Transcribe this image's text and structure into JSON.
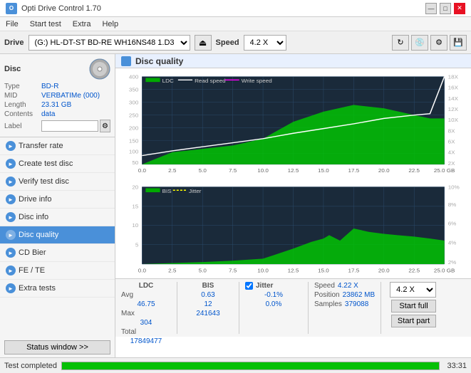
{
  "titlebar": {
    "title": "Opti Drive Control 1.70",
    "icon_label": "O",
    "controls": [
      "—",
      "□",
      "✕"
    ]
  },
  "menubar": {
    "items": [
      "File",
      "Start test",
      "Extra",
      "Help"
    ]
  },
  "drivebar": {
    "label": "Drive",
    "drive_value": "(G:)  HL-DT-ST BD-RE  WH16NS48 1.D3",
    "speed_label": "Speed",
    "speed_value": "4.2 X"
  },
  "disc": {
    "title": "Disc",
    "type_label": "Type",
    "type_value": "BD-R",
    "mid_label": "MID",
    "mid_value": "VERBATIMe (000)",
    "length_label": "Length",
    "length_value": "23.31 GB",
    "contents_label": "Contents",
    "contents_value": "data",
    "label_label": "Label"
  },
  "nav": {
    "items": [
      {
        "id": "transfer-rate",
        "label": "Transfer rate",
        "active": false
      },
      {
        "id": "create-test-disc",
        "label": "Create test disc",
        "active": false
      },
      {
        "id": "verify-test-disc",
        "label": "Verify test disc",
        "active": false
      },
      {
        "id": "drive-info",
        "label": "Drive info",
        "active": false
      },
      {
        "id": "disc-info",
        "label": "Disc info",
        "active": false
      },
      {
        "id": "disc-quality",
        "label": "Disc quality",
        "active": true
      },
      {
        "id": "cd-bier",
        "label": "CD Bier",
        "active": false
      },
      {
        "id": "fe-te",
        "label": "FE / TE",
        "active": false
      },
      {
        "id": "extra-tests",
        "label": "Extra tests",
        "active": false
      }
    ],
    "status_window": "Status window >>"
  },
  "chart": {
    "title": "Disc quality",
    "legend1": {
      "ldc": "LDC",
      "read_speed": "Read speed",
      "write_speed": "Write speed"
    },
    "legend2": {
      "bis": "BIS",
      "jitter": "Jitter"
    },
    "y_axis1_left": [
      "400",
      "350",
      "300",
      "250",
      "200",
      "150",
      "100",
      "50"
    ],
    "y_axis1_right": [
      "18X",
      "16X",
      "14X",
      "12X",
      "10X",
      "8X",
      "6X",
      "4X",
      "2X"
    ],
    "x_axis1": [
      "0.0",
      "2.5",
      "5.0",
      "7.5",
      "10.0",
      "12.5",
      "15.0",
      "17.5",
      "20.0",
      "22.5",
      "25.0 GB"
    ],
    "y_axis2_left": [
      "20",
      "15",
      "10",
      "5"
    ],
    "y_axis2_right": [
      "10%",
      "8%",
      "6%",
      "4%",
      "2%"
    ],
    "x_axis2": [
      "0.0",
      "2.5",
      "5.0",
      "7.5",
      "10.0",
      "12.5",
      "15.0",
      "17.5",
      "20.0",
      "22.5",
      "25.0 GB"
    ]
  },
  "stats": {
    "col_headers": [
      "LDC",
      "BIS",
      "",
      "Jitter",
      "Speed",
      ""
    ],
    "avg_label": "Avg",
    "max_label": "Max",
    "total_label": "Total",
    "ldc_avg": "46.75",
    "ldc_max": "304",
    "ldc_total": "17849477",
    "bis_avg": "0.63",
    "bis_max": "12",
    "bis_total": "241643",
    "jitter_avg": "-0.1%",
    "jitter_max": "0.0%",
    "speed_label": "Speed",
    "speed_value": "4.22 X",
    "position_label": "Position",
    "position_value": "23862 MB",
    "samples_label": "Samples",
    "samples_value": "379088",
    "speed_select": "4.2 X",
    "start_full": "Start full",
    "start_part": "Start part"
  },
  "statusbar": {
    "text": "Test completed",
    "progress": 100,
    "time": "33:31"
  }
}
